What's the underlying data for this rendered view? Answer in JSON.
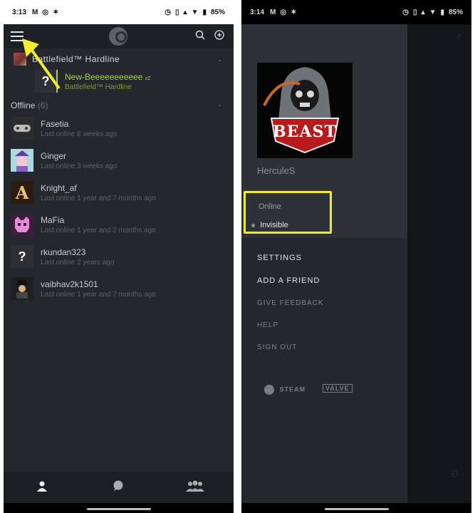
{
  "left": {
    "status_bar": {
      "time": "3:13",
      "battery": "85%"
    },
    "top_bar": {
      "menu_icon": "hamburger-icon",
      "logo": "steam-logo-icon"
    },
    "game_group": {
      "title": "Battlefield™ Hardline"
    },
    "in_game_friend": {
      "name": "New-Beeeeeeeeeee",
      "zz": "zZ",
      "game": "Battlefield™ Hardline",
      "avatar_char": "?"
    },
    "offline": {
      "label": "Offline",
      "count": "(6)"
    },
    "friends": [
      {
        "name": "Fasetia",
        "status": "Last online 8 weeks ago",
        "avatar": "#2c2c2c"
      },
      {
        "name": "Ginger",
        "status": "Last online 3 weeks ago",
        "avatar": "#9fd3d8"
      },
      {
        "name": "Knight_af",
        "status": "Last online 1 year and 7 months ago",
        "avatar": "#3a2b1a"
      },
      {
        "name": "MaFia",
        "status": "Last online 1 year and 2 months ago",
        "avatar": "#3b1f3a"
      },
      {
        "name": "rkundan323",
        "status": "Last online 2 years ago",
        "avatar": "#2f2f33"
      },
      {
        "name": "vaibhav2k1501",
        "status": "Last online 1 year and 7 months ago",
        "avatar": "#1f1f22"
      }
    ],
    "question_mark": "?",
    "knight_letter": "A"
  },
  "right": {
    "status_bar": {
      "time": "3:14",
      "battery": "85%"
    },
    "profile": {
      "badge_text": "BEAST",
      "name": "HerculeS"
    },
    "status_options": {
      "online": "Online",
      "invisible": "Invisible"
    },
    "menu": {
      "settings": "SETTINGS",
      "add_friend": "ADD A FRIEND",
      "give_feedback": "GIVE FEEDBACK",
      "help": "HELP",
      "sign_out": "SIGN OUT"
    },
    "brands": {
      "steam": "STEAM",
      "valve": "VALVE"
    }
  },
  "colors": {
    "annotation": "#f3ec2d",
    "in_game_green": "#a5d05a"
  }
}
